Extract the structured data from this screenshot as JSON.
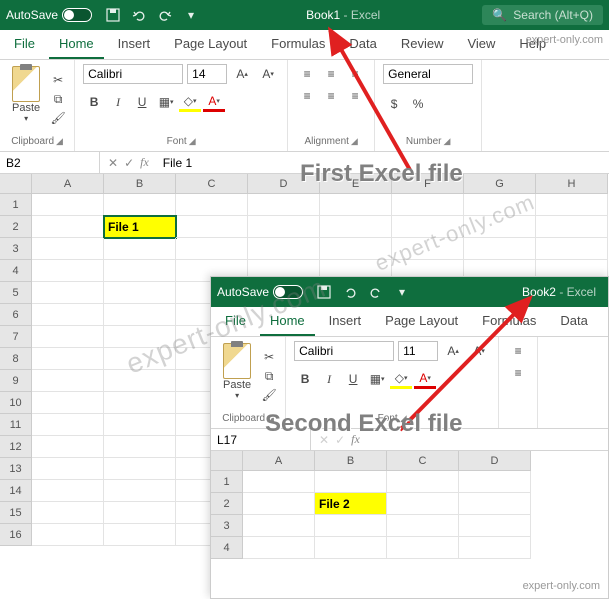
{
  "win1": {
    "title": {
      "book": "Book1",
      "app": "Excel",
      "autosave": "AutoSave",
      "search": "Search (Alt+Q)"
    },
    "tabs": [
      "File",
      "Home",
      "Insert",
      "Page Layout",
      "Formulas",
      "Data",
      "Review",
      "View",
      "Help"
    ],
    "active_tab": "Home",
    "ribbon": {
      "clipboard": {
        "label": "Clipboard",
        "paste": "Paste"
      },
      "font": {
        "label": "Font",
        "name": "Calibri",
        "size": "14",
        "bold": "B",
        "italic": "I",
        "underline": "U"
      },
      "alignment": {
        "label": "Alignment"
      },
      "number": {
        "label": "Number",
        "format": "General"
      }
    },
    "namebox": "B2",
    "formula": "File 1",
    "columns": [
      "A",
      "B",
      "C",
      "D",
      "E",
      "F",
      "G",
      "H"
    ],
    "rows": [
      "1",
      "2",
      "3",
      "4",
      "5",
      "6",
      "7",
      "8",
      "9",
      "10",
      "11",
      "12",
      "13",
      "14",
      "15",
      "16"
    ],
    "cell_b2": "File 1"
  },
  "win2": {
    "title": {
      "book": "Book2",
      "app": "Excel",
      "autosave": "AutoSave"
    },
    "tabs": [
      "File",
      "Home",
      "Insert",
      "Page Layout",
      "Formulas",
      "Data"
    ],
    "active_tab": "Home",
    "ribbon": {
      "clipboard": {
        "label": "Clipboard",
        "paste": "Paste"
      },
      "font": {
        "label": "Font",
        "name": "Calibri",
        "size": "11",
        "bold": "B",
        "italic": "I",
        "underline": "U"
      }
    },
    "namebox": "L17",
    "formula": "",
    "columns": [
      "A",
      "B",
      "C",
      "D"
    ],
    "rows": [
      "1",
      "2",
      "3",
      "4"
    ],
    "cell_b2": "File 2"
  },
  "annotations": {
    "first": "First Excel file",
    "second": "Second Excel file"
  },
  "watermark": "expert-only.com"
}
